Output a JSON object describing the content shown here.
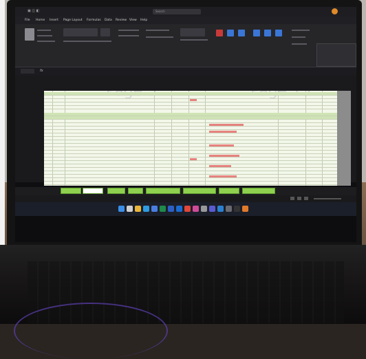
{
  "excel": {
    "search_placeholder": "Search",
    "menu": [
      "File",
      "Home",
      "Insert",
      "Page Layout",
      "Formulas",
      "Data",
      "Review",
      "View",
      "Help"
    ],
    "page_label_left": "Page 3",
    "page_label_right": "Page 15"
  },
  "sheet_tabs": [
    "",
    "",
    "",
    "",
    "",
    "",
    "",
    ""
  ],
  "colors": {
    "sheet_background": "#f3f7ea",
    "tab_green": "#8fd14f",
    "header_row_green": "#cfe3b4",
    "accent_red": "#c23030",
    "taskbar": "#1b1f2a"
  },
  "taskbar_icons": [
    "start-icon",
    "search-icon",
    "file-explorer-icon",
    "edge-icon",
    "store-icon",
    "excel-icon",
    "word-icon",
    "outlook-icon",
    "chrome-icon",
    "photos-icon",
    "settings-icon",
    "teams-icon",
    "mail-icon",
    "calculator-icon",
    "terminal-icon",
    "app-icon"
  ]
}
